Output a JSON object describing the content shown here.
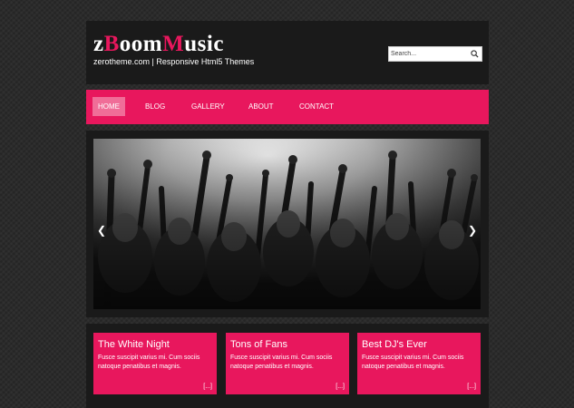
{
  "header": {
    "logo": {
      "part1": "z",
      "part2": "B",
      "part3": "oom",
      "part4": "M",
      "part5": "usic"
    },
    "tagline": "zerotheme.com | Responsive Html5 Themes",
    "search": {
      "placeholder": "Search..."
    }
  },
  "nav": {
    "items": [
      {
        "label": "HOME",
        "active": true
      },
      {
        "label": "BLOG"
      },
      {
        "label": "GALLERY"
      },
      {
        "label": "ABOUT"
      },
      {
        "label": "CONTACT"
      }
    ]
  },
  "slider": {
    "prev_icon": "chevron-left-icon",
    "next_icon": "chevron-right-icon",
    "image": "concert-crowd-photo"
  },
  "features": [
    {
      "title": "The White Night",
      "text": "Fusce suscipit varius mi. Cum sociis natoque penatibus et magnis.",
      "more": "[...]"
    },
    {
      "title": "Tons of Fans",
      "text": "Fusce suscipit varius mi. Cum sociis natoque penatibus et magnis.",
      "more": "[...]"
    },
    {
      "title": "Best DJ's Ever",
      "text": "Fusce suscipit varius mi. Cum sociis natoque penatibus et magnis.",
      "more": "[...]"
    }
  ],
  "colors": {
    "accent": "#e8175d",
    "active_nav": "#f06d98",
    "panel": "#1a1a1a",
    "background": "#2b2b2b"
  }
}
